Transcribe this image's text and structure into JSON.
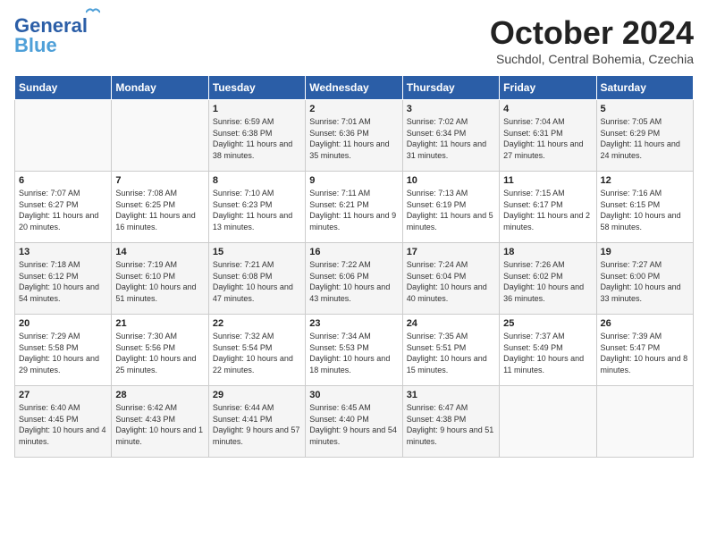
{
  "header": {
    "logo_line1": "General",
    "logo_line2": "Blue",
    "month": "October 2024",
    "location": "Suchdol, Central Bohemia, Czechia"
  },
  "days_of_week": [
    "Sunday",
    "Monday",
    "Tuesday",
    "Wednesday",
    "Thursday",
    "Friday",
    "Saturday"
  ],
  "weeks": [
    [
      {
        "day": "",
        "info": ""
      },
      {
        "day": "",
        "info": ""
      },
      {
        "day": "1",
        "info": "Sunrise: 6:59 AM\nSunset: 6:38 PM\nDaylight: 11 hours and 38 minutes."
      },
      {
        "day": "2",
        "info": "Sunrise: 7:01 AM\nSunset: 6:36 PM\nDaylight: 11 hours and 35 minutes."
      },
      {
        "day": "3",
        "info": "Sunrise: 7:02 AM\nSunset: 6:34 PM\nDaylight: 11 hours and 31 minutes."
      },
      {
        "day": "4",
        "info": "Sunrise: 7:04 AM\nSunset: 6:31 PM\nDaylight: 11 hours and 27 minutes."
      },
      {
        "day": "5",
        "info": "Sunrise: 7:05 AM\nSunset: 6:29 PM\nDaylight: 11 hours and 24 minutes."
      }
    ],
    [
      {
        "day": "6",
        "info": "Sunrise: 7:07 AM\nSunset: 6:27 PM\nDaylight: 11 hours and 20 minutes."
      },
      {
        "day": "7",
        "info": "Sunrise: 7:08 AM\nSunset: 6:25 PM\nDaylight: 11 hours and 16 minutes."
      },
      {
        "day": "8",
        "info": "Sunrise: 7:10 AM\nSunset: 6:23 PM\nDaylight: 11 hours and 13 minutes."
      },
      {
        "day": "9",
        "info": "Sunrise: 7:11 AM\nSunset: 6:21 PM\nDaylight: 11 hours and 9 minutes."
      },
      {
        "day": "10",
        "info": "Sunrise: 7:13 AM\nSunset: 6:19 PM\nDaylight: 11 hours and 5 minutes."
      },
      {
        "day": "11",
        "info": "Sunrise: 7:15 AM\nSunset: 6:17 PM\nDaylight: 11 hours and 2 minutes."
      },
      {
        "day": "12",
        "info": "Sunrise: 7:16 AM\nSunset: 6:15 PM\nDaylight: 10 hours and 58 minutes."
      }
    ],
    [
      {
        "day": "13",
        "info": "Sunrise: 7:18 AM\nSunset: 6:12 PM\nDaylight: 10 hours and 54 minutes."
      },
      {
        "day": "14",
        "info": "Sunrise: 7:19 AM\nSunset: 6:10 PM\nDaylight: 10 hours and 51 minutes."
      },
      {
        "day": "15",
        "info": "Sunrise: 7:21 AM\nSunset: 6:08 PM\nDaylight: 10 hours and 47 minutes."
      },
      {
        "day": "16",
        "info": "Sunrise: 7:22 AM\nSunset: 6:06 PM\nDaylight: 10 hours and 43 minutes."
      },
      {
        "day": "17",
        "info": "Sunrise: 7:24 AM\nSunset: 6:04 PM\nDaylight: 10 hours and 40 minutes."
      },
      {
        "day": "18",
        "info": "Sunrise: 7:26 AM\nSunset: 6:02 PM\nDaylight: 10 hours and 36 minutes."
      },
      {
        "day": "19",
        "info": "Sunrise: 7:27 AM\nSunset: 6:00 PM\nDaylight: 10 hours and 33 minutes."
      }
    ],
    [
      {
        "day": "20",
        "info": "Sunrise: 7:29 AM\nSunset: 5:58 PM\nDaylight: 10 hours and 29 minutes."
      },
      {
        "day": "21",
        "info": "Sunrise: 7:30 AM\nSunset: 5:56 PM\nDaylight: 10 hours and 25 minutes."
      },
      {
        "day": "22",
        "info": "Sunrise: 7:32 AM\nSunset: 5:54 PM\nDaylight: 10 hours and 22 minutes."
      },
      {
        "day": "23",
        "info": "Sunrise: 7:34 AM\nSunset: 5:53 PM\nDaylight: 10 hours and 18 minutes."
      },
      {
        "day": "24",
        "info": "Sunrise: 7:35 AM\nSunset: 5:51 PM\nDaylight: 10 hours and 15 minutes."
      },
      {
        "day": "25",
        "info": "Sunrise: 7:37 AM\nSunset: 5:49 PM\nDaylight: 10 hours and 11 minutes."
      },
      {
        "day": "26",
        "info": "Sunrise: 7:39 AM\nSunset: 5:47 PM\nDaylight: 10 hours and 8 minutes."
      }
    ],
    [
      {
        "day": "27",
        "info": "Sunrise: 6:40 AM\nSunset: 4:45 PM\nDaylight: 10 hours and 4 minutes."
      },
      {
        "day": "28",
        "info": "Sunrise: 6:42 AM\nSunset: 4:43 PM\nDaylight: 10 hours and 1 minute."
      },
      {
        "day": "29",
        "info": "Sunrise: 6:44 AM\nSunset: 4:41 PM\nDaylight: 9 hours and 57 minutes."
      },
      {
        "day": "30",
        "info": "Sunrise: 6:45 AM\nSunset: 4:40 PM\nDaylight: 9 hours and 54 minutes."
      },
      {
        "day": "31",
        "info": "Sunrise: 6:47 AM\nSunset: 4:38 PM\nDaylight: 9 hours and 51 minutes."
      },
      {
        "day": "",
        "info": ""
      },
      {
        "day": "",
        "info": ""
      }
    ]
  ]
}
